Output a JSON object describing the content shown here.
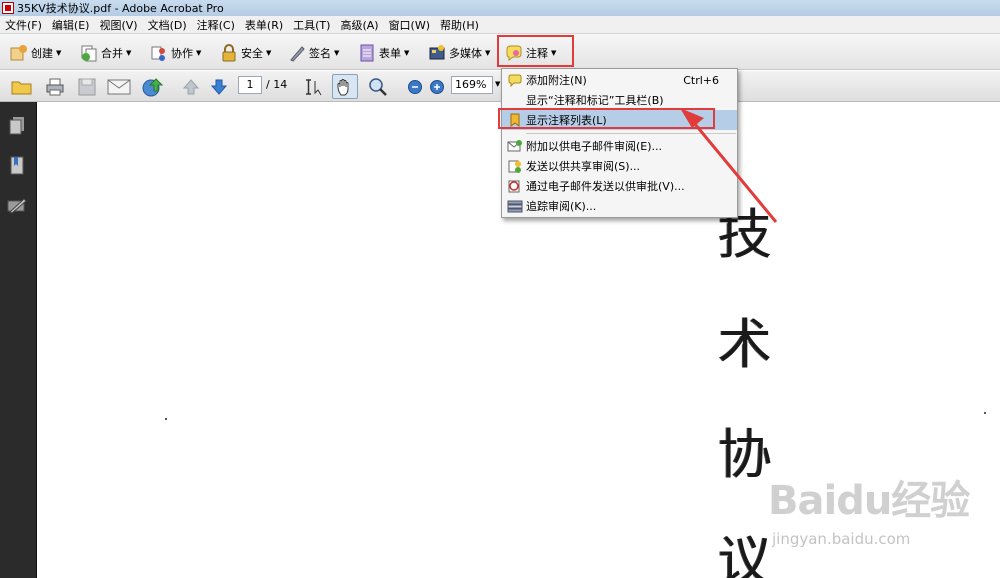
{
  "window": {
    "title": "35KV技术协议.pdf - Adobe Acrobat Pro"
  },
  "menubar": [
    "文件(F)",
    "编辑(E)",
    "视图(V)",
    "文档(D)",
    "注释(C)",
    "表单(R)",
    "工具(T)",
    "高级(A)",
    "窗口(W)",
    "帮助(H)"
  ],
  "toolbar": {
    "create": "创建",
    "combine": "合并",
    "collaborate": "协作",
    "secure": "安全",
    "sign": "签名",
    "forms": "表单",
    "multimedia": "多媒体",
    "comment": "注释"
  },
  "nav": {
    "page_current": "1",
    "page_total": "/ 14",
    "zoom": "169%"
  },
  "dropdown": {
    "items": [
      {
        "label": "添加附注(N)",
        "shortcut": "Ctrl+6"
      },
      {
        "label": "显示“注释和标记”工具栏(B)",
        "shortcut": ""
      },
      {
        "label": "显示注释列表(L)",
        "shortcut": ""
      },
      {
        "label": "附加以供电子邮件审阅(E)...",
        "shortcut": ""
      },
      {
        "label": "发送以供共享审阅(S)...",
        "shortcut": ""
      },
      {
        "label": "通过电子邮件发送以供审批(V)...",
        "shortcut": ""
      },
      {
        "label": "追踪审阅(K)...",
        "shortcut": ""
      }
    ]
  },
  "document": {
    "chars": [
      "技",
      "术",
      "协",
      "议"
    ]
  },
  "watermark": {
    "logo": "Baidu经验",
    "url": "jingyan.baidu.com"
  },
  "colors": {
    "highlight_box": "#e23b3b",
    "menu_highlight": "#b5cde6"
  }
}
